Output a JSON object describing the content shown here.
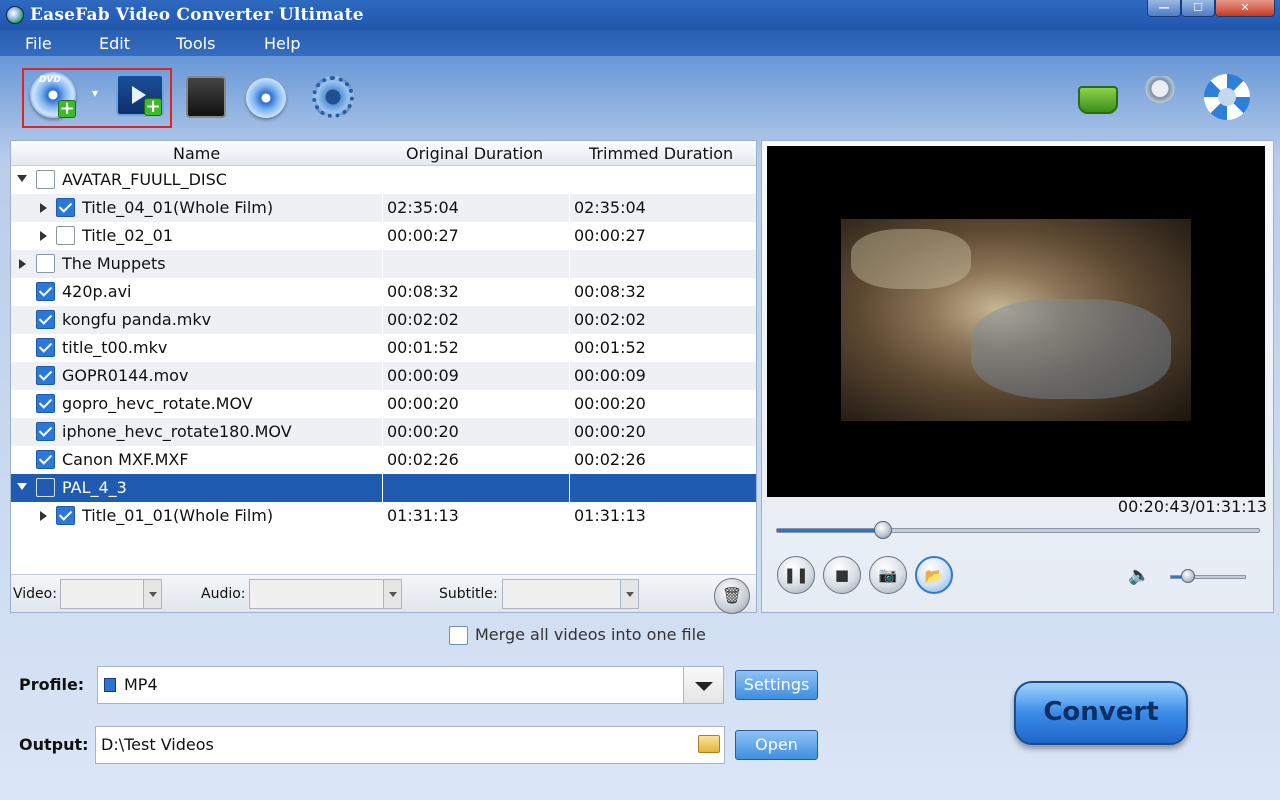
{
  "window": {
    "title": "EaseFab Video Converter Ultimate",
    "min_symbol": "—",
    "max_symbol": "☐",
    "close_symbol": "✕"
  },
  "menu": {
    "file": "File",
    "edit": "Edit",
    "tools": "Tools",
    "help": "Help"
  },
  "toolbar": {
    "icons": {
      "load_disc": "dvd-load-icon",
      "add_video": "add-video-icon",
      "edit": "film-edit-icon",
      "merge_disc": "disc-copy-icon",
      "settings": "gear-icon",
      "buy": "basket-icon",
      "register": "keys-icon",
      "help": "lifebuoy-icon"
    },
    "dvd_badge": "DVD",
    "plus": "+",
    "dropdown_arrow": "▾"
  },
  "list": {
    "columns": [
      "Name",
      "Original Duration",
      "Trimmed Duration"
    ],
    "rows": [
      {
        "name": "AVATAR_FUULL_DISC",
        "original": "",
        "trimmed": ""
      },
      {
        "name": "Title_04_01(Whole Film)",
        "original": "02:35:04",
        "trimmed": "02:35:04"
      },
      {
        "name": "Title_02_01",
        "original": "00:00:27",
        "trimmed": "00:00:27"
      },
      {
        "name": "The Muppets",
        "original": "",
        "trimmed": ""
      },
      {
        "name": "420p.avi",
        "original": "00:08:32",
        "trimmed": "00:08:32"
      },
      {
        "name": "kongfu panda.mkv",
        "original": "00:02:02",
        "trimmed": "00:02:02"
      },
      {
        "name": "title_t00.mkv",
        "original": "00:01:52",
        "trimmed": "00:01:52"
      },
      {
        "name": "GOPR0144.mov",
        "original": "00:00:09",
        "trimmed": "00:00:09"
      },
      {
        "name": "gopro_hevc_rotate.MOV",
        "original": "00:00:20",
        "trimmed": "00:00:20"
      },
      {
        "name": "iphone_hevc_rotate180.MOV",
        "original": "00:00:20",
        "trimmed": "00:00:20"
      },
      {
        "name": "Canon MXF.MXF",
        "original": "00:02:26",
        "trimmed": "00:02:26"
      },
      {
        "name": "PAL_4_3",
        "original": "",
        "trimmed": ""
      },
      {
        "name": "Title_01_01(Whole Film)",
        "original": "01:31:13",
        "trimmed": "01:31:13"
      }
    ],
    "video_label": "Video:",
    "audio_label": "Audio:",
    "subtitle_label": "Subtitle:",
    "trash_symbol": "🗑"
  },
  "player": {
    "timecode": "00:20:43/01:31:13",
    "progress": 0.22,
    "volume": 0.23,
    "pause_symbol": "❚❚",
    "stop_symbol": "■",
    "snapshot_symbol": "📷",
    "folder_symbol": "📂",
    "volume_symbol": "🔈"
  },
  "options": {
    "merge_label": "Merge all videos into one file"
  },
  "profile": {
    "label": "Profile:",
    "value": "MP4",
    "settings_button": "Settings"
  },
  "output": {
    "label": "Output:",
    "value": "D:\\Test Videos",
    "open_button": "Open"
  },
  "convert_button": "Convert"
}
